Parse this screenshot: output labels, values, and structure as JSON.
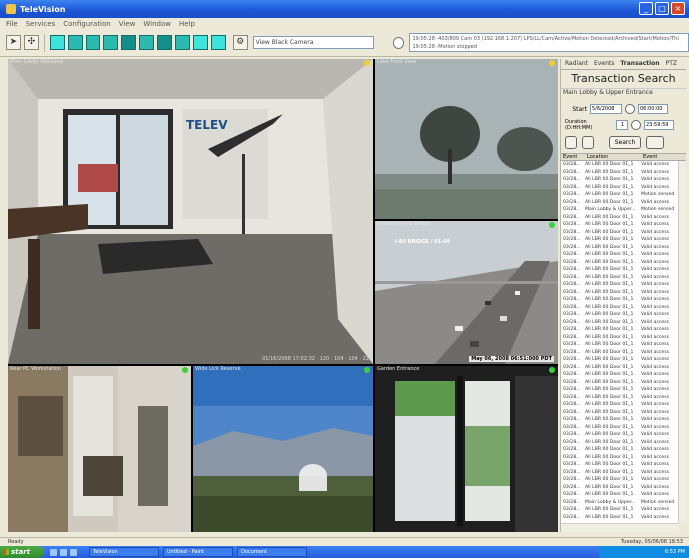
{
  "window": {
    "title": "TeleVision",
    "buttons": [
      "_",
      "□",
      "×"
    ]
  },
  "menu": [
    "File",
    "Services",
    "Configuration",
    "View",
    "Window",
    "Help"
  ],
  "toolbar": {
    "camera_select": "View Black Camera",
    "log_lines": [
      "19:05:28 -403/809 Cam 03 (192.168.1.207) LPS/LL/Cam/Active/Motion Detected/Archived/Start/Motion/Thl",
      "19:05:28 -Motion stopped"
    ]
  },
  "video": {
    "panes": [
      {
        "label": "Main Lobby Welcome",
        "status": "yellow",
        "overlay": "",
        "timestamp": "01/16/2008 17:02:32 · 120 · 104 · 104 · 22"
      },
      {
        "label": "Lake Front View",
        "status": "yellow",
        "overlay": "",
        "timestamp": ""
      },
      {
        "label": "Interstate/I-80 Bridge",
        "status": "green",
        "overlay": "I-80 BRIDGE / 01-08",
        "timestamp": "May 06, 2008  06:51:000 PDT"
      },
      {
        "label": "Rear PC Workstation",
        "status": "green",
        "overlay": "",
        "timestamp": ""
      },
      {
        "label": "Wide Lick Reserve",
        "status": "green",
        "overlay": "",
        "timestamp": ""
      },
      {
        "label": "Garden Entrance",
        "status": "green",
        "overlay": "",
        "timestamp": ""
      }
    ]
  },
  "panel": {
    "tabs": [
      "Radiant",
      "Events",
      "Transaction",
      "PTZ"
    ],
    "title": "Transaction Search",
    "subtitle": "Main Lobby & Upper Entrance",
    "start_label": "Start",
    "start_date": "5/6/2008",
    "start_time": "06:00:00",
    "duration_label": "Duration (D:HH:MM)",
    "duration_value": "1",
    "duration_time": "23:59:59",
    "search_button": "Search",
    "columns": [
      "Event",
      "Location",
      "Event"
    ],
    "rows": [
      [
        "03/28...",
        "All LBR 00 Door 01_1",
        "Valid access"
      ],
      [
        "03/28...",
        "All LBR 00 Door 01_1",
        "Valid access"
      ],
      [
        "03/28...",
        "All LBR 00 Door 01_1",
        "Valid access"
      ],
      [
        "03/28...",
        "All LBR 00 Door 01_1",
        "Valid access"
      ],
      [
        "03/28...",
        "All LBR 00 Door 01_1",
        "Motion sensed"
      ],
      [
        "03/28...",
        "All LBR 00 Door 01_1",
        "Valid access"
      ],
      [
        "03/28...",
        "Main Lobby & Upper...",
        "Motion sensed"
      ],
      [
        "03/28...",
        "All LBR 00 Door 01_1",
        "Valid access"
      ],
      [
        "03/28...",
        "All LBR 00 Door 01_1",
        "Valid access"
      ],
      [
        "03/28...",
        "All LBR 00 Door 01_1",
        "Valid access"
      ],
      [
        "03/28...",
        "All LBR 00 Door 01_1",
        "Valid access"
      ],
      [
        "03/28...",
        "All LBR 00 Door 01_1",
        "Valid access"
      ],
      [
        "03/28...",
        "All LBR 00 Door 01_1",
        "Valid access"
      ],
      [
        "03/28...",
        "All LBR 00 Door 01_1",
        "Valid access"
      ],
      [
        "03/28...",
        "All LBR 00 Door 01_1",
        "Valid access"
      ],
      [
        "03/28...",
        "All LBR 00 Door 01_1",
        "Valid access"
      ],
      [
        "03/28...",
        "All LBR 00 Door 01_1",
        "Valid access"
      ],
      [
        "03/28...",
        "All LBR 00 Door 01_1",
        "Valid access"
      ],
      [
        "03/28...",
        "All LBR 00 Door 01_1",
        "Valid access"
      ],
      [
        "03/28...",
        "All LBR 00 Door 01_1",
        "Valid access"
      ],
      [
        "03/28...",
        "All LBR 00 Door 01_1",
        "Valid access"
      ],
      [
        "03/28...",
        "All LBR 00 Door 01_1",
        "Valid access"
      ],
      [
        "03/28...",
        "All LBR 00 Door 01_1",
        "Valid access"
      ],
      [
        "03/28...",
        "All LBR 00 Door 01_1",
        "Valid access"
      ],
      [
        "03/28...",
        "All LBR 00 Door 01_1",
        "Valid access"
      ],
      [
        "03/28...",
        "All LBR 00 Door 01_1",
        "Valid access"
      ],
      [
        "03/28...",
        "All LBR 00 Door 01_1",
        "Valid access"
      ],
      [
        "03/28...",
        "All LBR 00 Door 01_1",
        "Valid access"
      ],
      [
        "03/28...",
        "All LBR 00 Door 01_1",
        "Valid access"
      ],
      [
        "03/28...",
        "All LBR 00 Door 01_1",
        "Valid access"
      ],
      [
        "03/28...",
        "All LBR 00 Door 01_1",
        "Valid access"
      ],
      [
        "03/28...",
        "All LBR 00 Door 01_1",
        "Valid access"
      ],
      [
        "03/28...",
        "All LBR 00 Door 01_1",
        "Valid access"
      ],
      [
        "03/28...",
        "All LBR 00 Door 01_1",
        "Valid access"
      ],
      [
        "03/28...",
        "All LBR 00 Door 01_1",
        "Valid access"
      ],
      [
        "03/28...",
        "All LBR 00 Door 01_1",
        "Valid access"
      ],
      [
        "03/28...",
        "All LBR 00 Door 01_1",
        "Valid access"
      ],
      [
        "03/28...",
        "All LBR 00 Door 01_1",
        "Valid access"
      ],
      [
        "03/28...",
        "All LBR 00 Door 01_1",
        "Valid access"
      ],
      [
        "03/28...",
        "All LBR 00 Door 01_1",
        "Valid access"
      ],
      [
        "03/28...",
        "All LBR 00 Door 01_1",
        "Valid access"
      ],
      [
        "03/28...",
        "All LBR 00 Door 01_1",
        "Valid access"
      ],
      [
        "03/28...",
        "All LBR 00 Door 01_1",
        "Valid access"
      ],
      [
        "03/28...",
        "All LBR 00 Door 01_1",
        "Valid access"
      ],
      [
        "03/28...",
        "All LBR 00 Door 01_1",
        "Valid access"
      ],
      [
        "03/28...",
        "Main Lobby & Upper...",
        "Motion sensed"
      ],
      [
        "03/28...",
        "All LBR 00 Door 01_1",
        "Valid access"
      ],
      [
        "03/28...",
        "All LBR 00 Door 01_1",
        "Valid access"
      ]
    ]
  },
  "status": {
    "left": "Ready",
    "right": "Tuesday, 05/06/08  18:53"
  },
  "taskbar": {
    "start": "start",
    "tasks": [
      "TeleVision",
      "Untitled - Paint",
      "Document"
    ],
    "clock": "6:53 PM"
  }
}
